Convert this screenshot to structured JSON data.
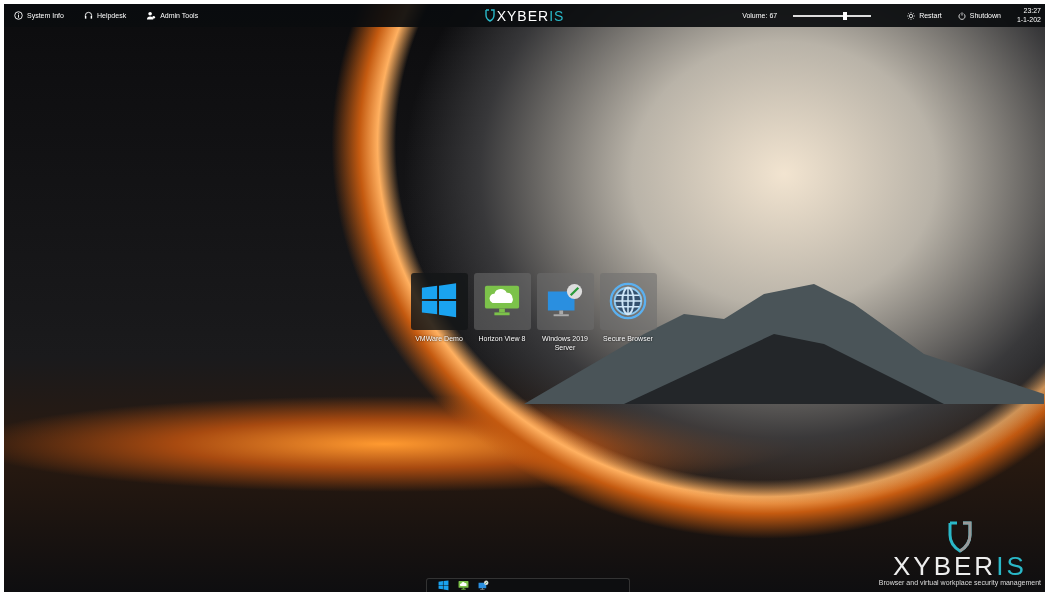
{
  "top_bar": {
    "left_items": [
      {
        "kind": "info",
        "label": "System Info"
      },
      {
        "kind": "headset",
        "label": "Helpdesk"
      },
      {
        "kind": "admin",
        "label": "Admin Tools"
      }
    ],
    "logo": {
      "main": "XYBER",
      "accent": "IS"
    },
    "volume": {
      "label": "Volume: 67",
      "level": 0.67
    },
    "actions": [
      {
        "kind": "restart",
        "label": "Restart"
      },
      {
        "kind": "power",
        "label": "Shutdown"
      }
    ],
    "clock": {
      "time": "23:27",
      "date": "1-1-202"
    }
  },
  "apps": [
    {
      "kind": "windows",
      "label": "VMWare Demo",
      "selected": true
    },
    {
      "kind": "cloud",
      "label": "Horizon View 8",
      "selected": false
    },
    {
      "kind": "remote",
      "label": "Windows 2019 Server",
      "selected": false
    },
    {
      "kind": "globe",
      "label": "Secure Browser",
      "selected": false
    }
  ],
  "taskbar": [
    {
      "kind": "windows"
    },
    {
      "kind": "cloud"
    },
    {
      "kind": "remote"
    }
  ],
  "corner_logo": {
    "main": "XYBER",
    "accent": "IS",
    "tagline": "Browser and virtual workplace security management"
  }
}
